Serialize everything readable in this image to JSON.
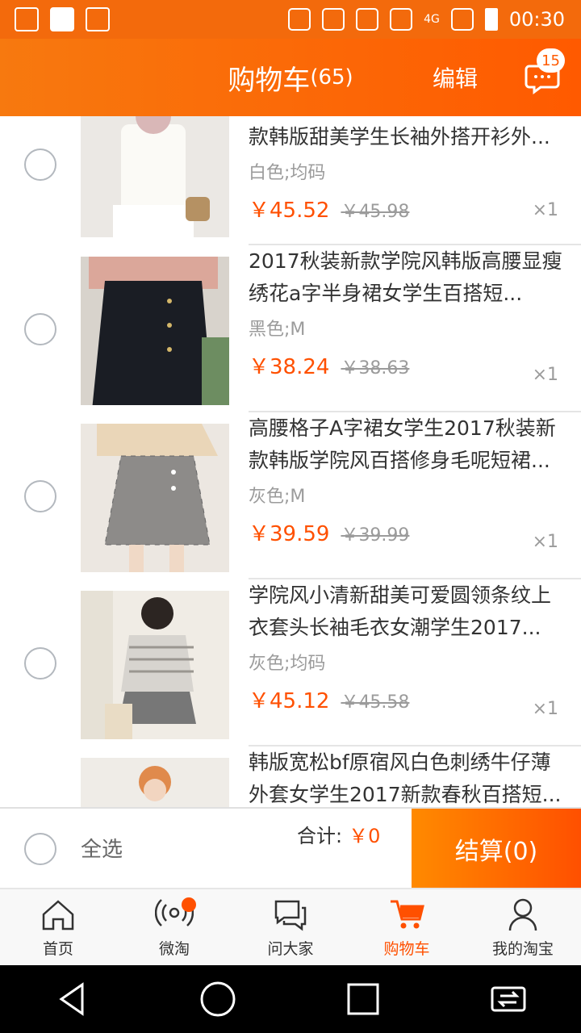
{
  "status_bar": {
    "time": "00:30",
    "network": "4G"
  },
  "header": {
    "title": "购物车",
    "count": "(65)",
    "edit_label": "编辑",
    "badge": "15"
  },
  "items": [
    {
      "name": "款韩版甜美学生长袖外搭开衫外...",
      "spec": "白色;均码",
      "price": "￥45.52",
      "orig": "￥45.98",
      "qty": "×1"
    },
    {
      "name": "2017秋装新款学院风韩版高腰显瘦绣花a字半身裙女学生百搭短...",
      "spec": "黑色;M",
      "price": "￥38.24",
      "orig": "￥38.63",
      "qty": "×1"
    },
    {
      "name": "高腰格子A字裙女学生2017秋装新款韩版学院风百搭修身毛呢短裙...",
      "spec": "灰色;M",
      "price": "￥39.59",
      "orig": "￥39.99",
      "qty": "×1"
    },
    {
      "name": "学院风小清新甜美可爱圆领条纹上衣套头长袖毛衣女潮学生2017...",
      "spec": "灰色;均码",
      "price": "￥45.12",
      "orig": "￥45.58",
      "qty": "×1"
    },
    {
      "name": "韩版宽松bf原宿风白色刺绣牛仔薄外套女学生2017新款春秋百搭短...",
      "spec": "",
      "price": "",
      "orig": "",
      "qty": ""
    }
  ],
  "footer": {
    "select_all": "全选",
    "total_label": "合计:",
    "total_value": "￥0",
    "checkout": "结算(0)"
  },
  "tabs": [
    {
      "label": "首页",
      "icon": "home-icon"
    },
    {
      "label": "微淘",
      "icon": "broadcast-icon"
    },
    {
      "label": "问大家",
      "icon": "chat-icon"
    },
    {
      "label": "购物车",
      "icon": "cart-icon"
    },
    {
      "label": "我的淘宝",
      "icon": "person-icon"
    }
  ],
  "colors": {
    "accent": "#ff5000",
    "header_bg": "#f7790f"
  }
}
